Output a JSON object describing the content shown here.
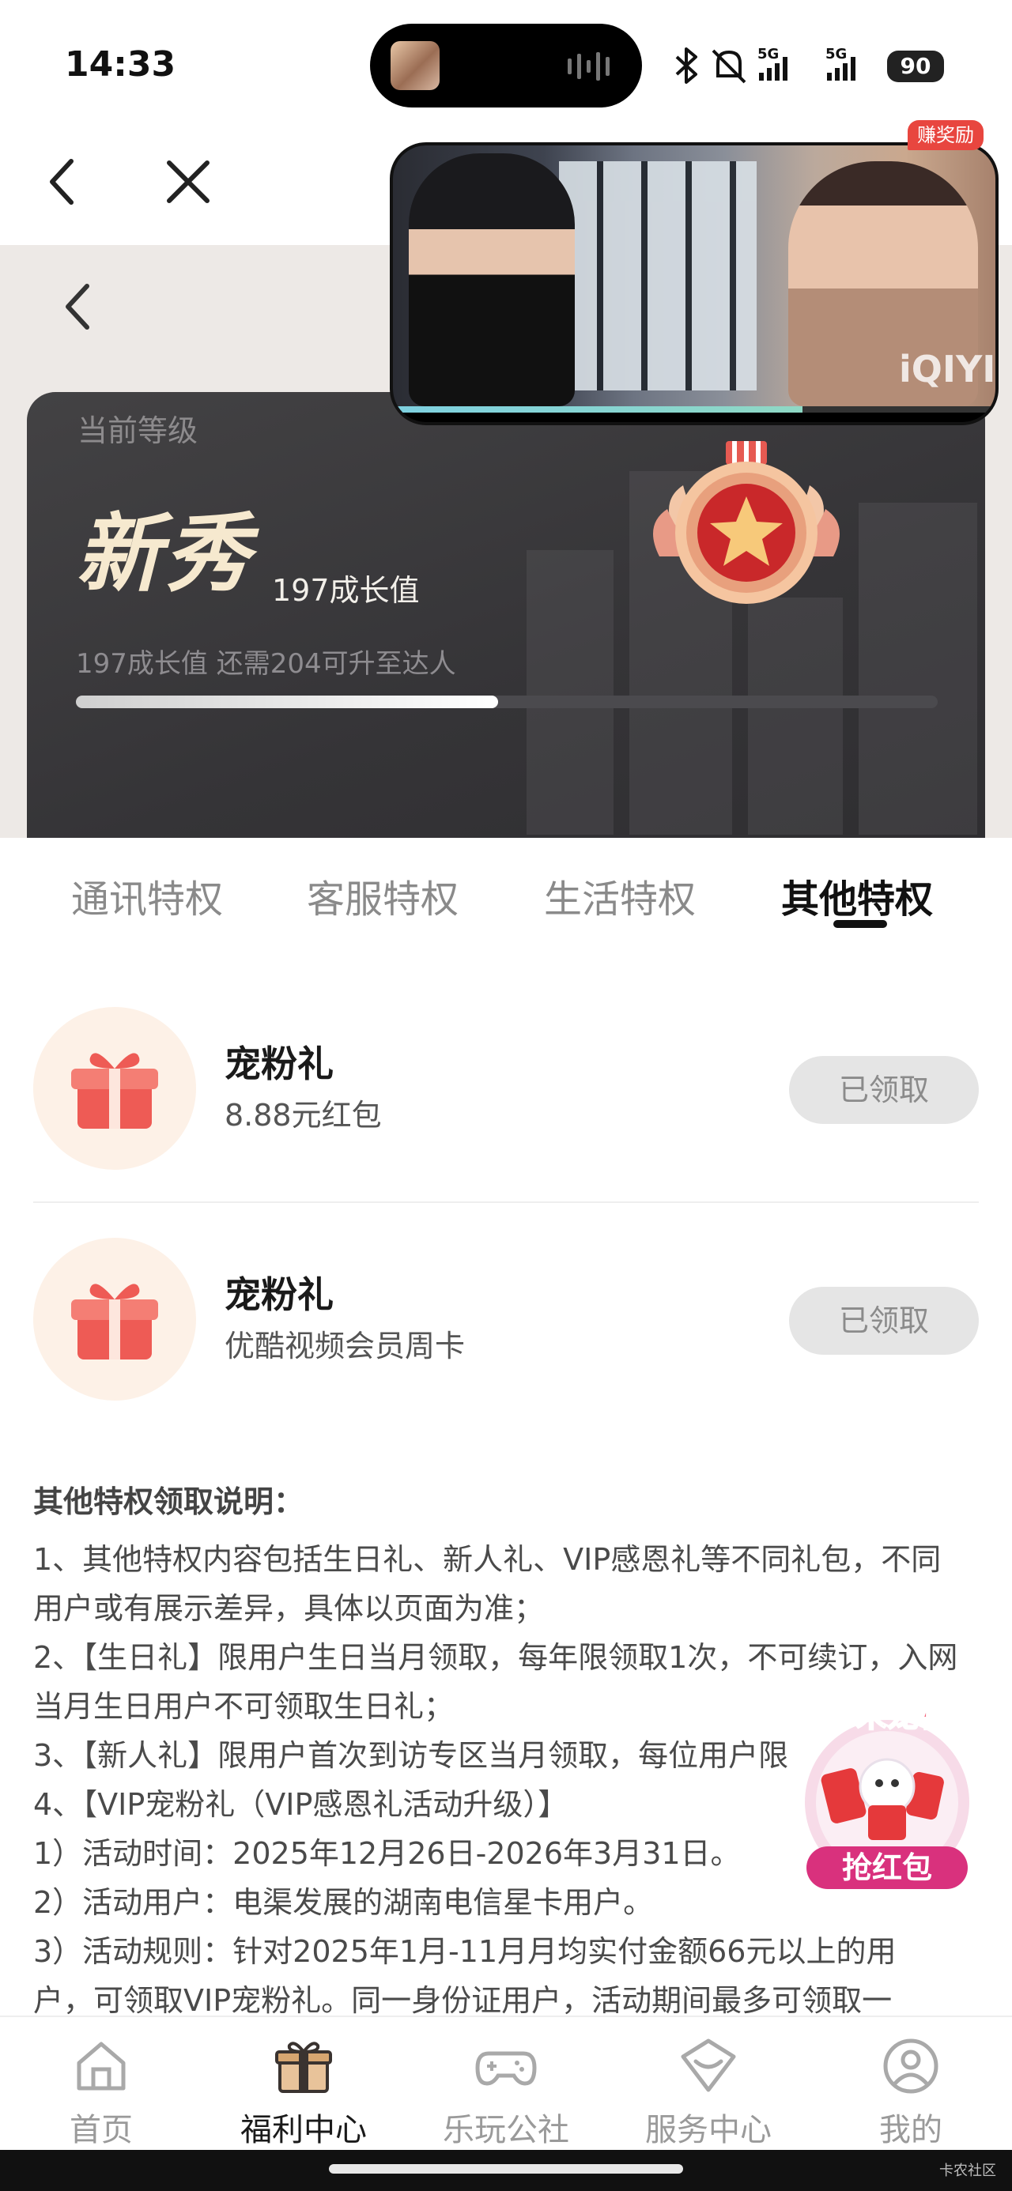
{
  "status_bar": {
    "time": "14:33",
    "network_1": "5G",
    "network_2": "5G",
    "battery": "90"
  },
  "nav": {
    "back_icon": "chevron-left-icon",
    "close_icon": "close-icon"
  },
  "pip": {
    "logo": "iQIYI",
    "reward_tag": "赚奖励",
    "progress": 0.68
  },
  "level_card": {
    "label": "当前等级",
    "level_name": "新秀",
    "growth_value": "197成长值",
    "progress_text": "197成长值 还需204可升至达人",
    "progress": 0.49
  },
  "tabs": [
    {
      "label": "通讯特权",
      "active": false
    },
    {
      "label": "客服特权",
      "active": false
    },
    {
      "label": "生活特权",
      "active": false
    },
    {
      "label": "其他特权",
      "active": true
    }
  ],
  "privileges": [
    {
      "title": "宠粉礼",
      "subtitle": "8.88元红包",
      "button": "已领取",
      "icon": "gift-icon"
    },
    {
      "title": "宠粉礼",
      "subtitle": "优酷视频会员周卡",
      "button": "已领取",
      "icon": "gift-icon"
    }
  ],
  "notes": {
    "title": "其他特权领取说明：",
    "lines": [
      "1、其他特权内容包括生日礼、新人礼、VIP感恩礼等不同礼包，不同",
      "用户或有展示差异，具体以页面为准；",
      "2、【生日礼】限用户生日当月领取，每年限领取1次，不可续订，入网",
      "当月生日用户不可领取生日礼；",
      "3、【新人礼】限用户首次到访专区当月领取，每位用户限",
      "4、【VIP宠粉礼（VIP感恩礼活动升级）】",
      "1）活动时间：2025年12月26日-2026年3月31日。",
      "2）活动用户：电渠发展的湖南电信星卡用户。",
      "3）活动规则：针对2025年1月-11月月均实付金额66元以上的用",
      "户，可领取VIP宠粉礼。同一身份证用户，活动期间最多可领取一"
    ]
  },
  "promo": {
    "title": "岁末宠粉",
    "button": "抢红包"
  },
  "bottom_nav": [
    {
      "label": "首页",
      "icon": "home-icon",
      "active": false
    },
    {
      "label": "福利中心",
      "icon": "gift-box-icon",
      "active": true
    },
    {
      "label": "乐玩公社",
      "icon": "gamepad-icon",
      "active": false
    },
    {
      "label": "服务中心",
      "icon": "service-icon",
      "active": false
    },
    {
      "label": "我的",
      "icon": "profile-icon",
      "active": false
    }
  ],
  "watermark": "卡农社区",
  "colors": {
    "accent_red": "#e8463f",
    "card_dark": "#353437",
    "level_gold": "#f6e9cf"
  }
}
